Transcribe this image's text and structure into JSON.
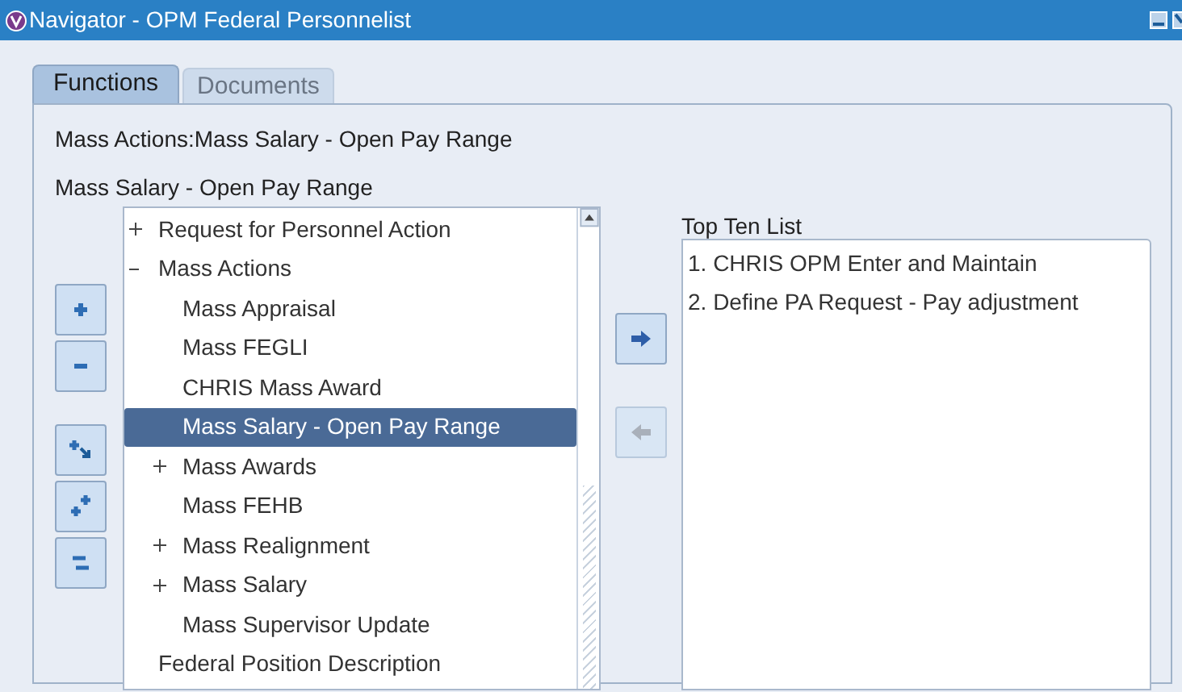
{
  "window": {
    "title": "Navigator - OPM Federal Personnelist"
  },
  "tabs": [
    {
      "label": "Functions",
      "selected": true
    },
    {
      "label": "Documents",
      "selected": false
    }
  ],
  "path": "Mass Actions:Mass Salary - Open Pay Range",
  "current": "Mass Salary - Open Pay Range",
  "tree": [
    {
      "label": "Request for Personnel Action",
      "expanded": false,
      "selected": false
    },
    {
      "label": "Mass Actions",
      "expanded": true,
      "selected": false,
      "children": [
        {
          "label": "Mass Appraisal",
          "selected": false
        },
        {
          "label": "Mass FEGLI",
          "selected": false
        },
        {
          "label": "CHRIS Mass Award",
          "selected": false
        },
        {
          "label": "Mass Salary - Open Pay Range",
          "selected": true
        },
        {
          "label": "Mass Awards",
          "expanded": false,
          "selected": false
        },
        {
          "label": "Mass FEHB",
          "selected": false
        },
        {
          "label": "Mass Realignment",
          "expanded": false,
          "selected": false
        },
        {
          "label": "Mass Salary",
          "expanded": false,
          "selected": false
        },
        {
          "label": "Mass Supervisor Update",
          "selected": false
        }
      ]
    },
    {
      "label": "Federal Position Description",
      "selected": false
    }
  ],
  "add_button": {
    "disabled": false
  },
  "remove_button": {
    "disabled": true
  },
  "top_ten": {
    "label": "Top Ten List",
    "items": [
      "1. CHRIS OPM Enter and Maintain",
      "2. Define PA Request - Pay adjustment"
    ]
  }
}
